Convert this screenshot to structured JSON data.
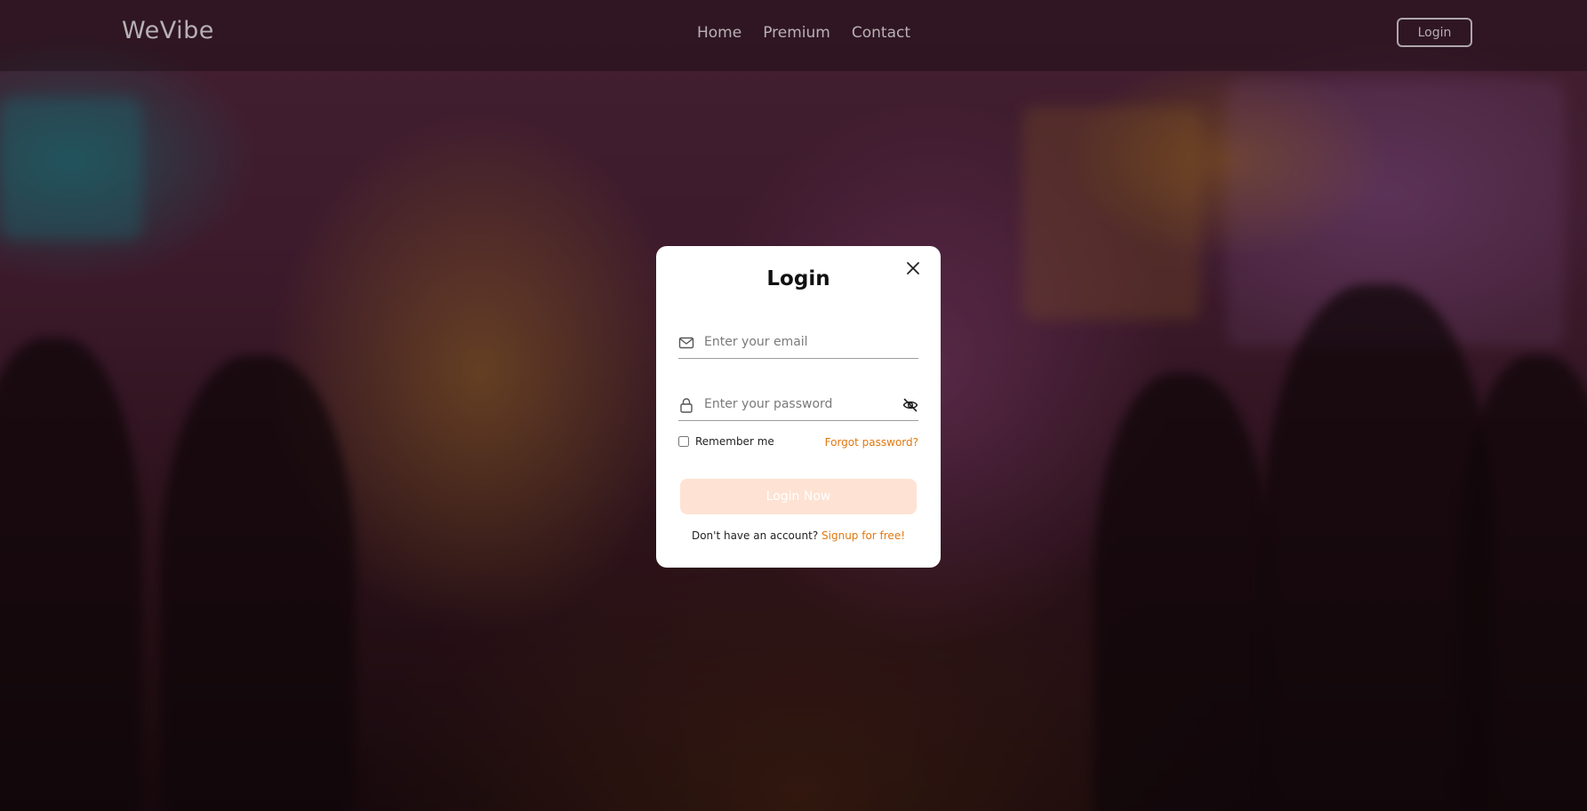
{
  "brand": {
    "name": "WeVibe"
  },
  "nav": {
    "links": [
      {
        "label": "Home"
      },
      {
        "label": "Premium"
      },
      {
        "label": "Contact"
      }
    ],
    "login_label": "Login"
  },
  "modal": {
    "title": "Login",
    "email_placeholder": "Enter your email",
    "password_placeholder": "Enter your password",
    "remember_label": "Remember me",
    "remember_checked": false,
    "forgot_label": "Forgot password?",
    "submit_label": "Login Now",
    "signup_prompt": "Don't have an account?",
    "signup_link": "Signup for free!"
  },
  "colors": {
    "accent": "#e0780f",
    "button_bg": "#fee2d3",
    "modal_bg": "#ffffff"
  },
  "icons": {
    "close": "close-icon",
    "email": "mail-icon",
    "password": "lock-icon",
    "toggle": "eye-slash-icon"
  }
}
